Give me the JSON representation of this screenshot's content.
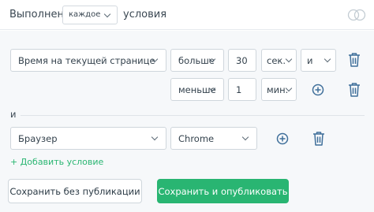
{
  "header": {
    "prefix": "Выполнено",
    "mode_select": "каждое",
    "suffix": "условия"
  },
  "condition_groups": [
    {
      "rows": [
        {
          "parameter": "Время на текущей странице",
          "operator": "больше",
          "value": "30",
          "unit": "сек.",
          "join": "и"
        },
        {
          "operator": "меньше",
          "value": "1",
          "unit": "мин."
        }
      ]
    },
    {
      "separator": "и",
      "rows": [
        {
          "parameter": "Браузер",
          "value": "Chrome"
        }
      ]
    }
  ],
  "add_condition": "+ Добавить условие",
  "buttons": {
    "save_no_publish": "Сохранить без публикации",
    "save_publish": "Сохранить и опубликовать"
  },
  "colors": {
    "accent": "#29b572",
    "icon": "#3f6f9a",
    "border": "#cfd6dc"
  },
  "icons": {
    "toggle": "toggle-icon",
    "add": "plus-circle-icon",
    "delete": "trash-icon",
    "dropdown": "chevron-down-icon"
  }
}
